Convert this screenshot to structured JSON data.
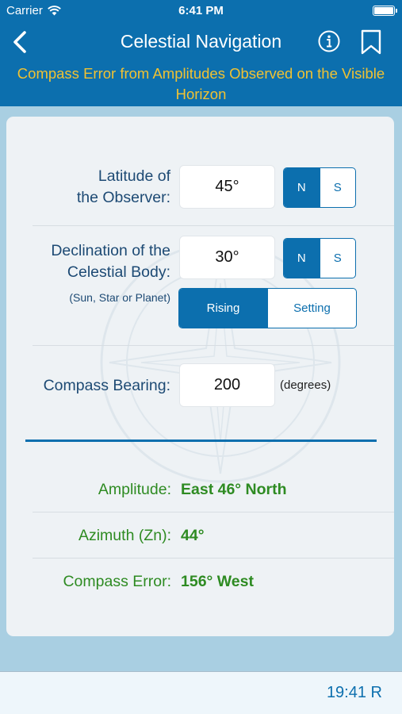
{
  "status": {
    "carrier": "Carrier",
    "time": "6:41 PM"
  },
  "nav": {
    "title": "Celestial Navigation",
    "subtitle": "Compass Error from Amplitudes Observed on the Visible Horizon"
  },
  "latitude": {
    "label_line1": "Latitude of",
    "label_line2": "the Observer:",
    "value": "45°",
    "hemisphere_options": [
      "N",
      "S"
    ],
    "selected": "N"
  },
  "declination": {
    "label_line1": "Declination of the",
    "label_line2": "Celestial Body:",
    "note": "(Sun, Star or Planet)",
    "value": "30°",
    "hemisphere_options": [
      "N",
      "S"
    ],
    "selected": "N",
    "event_options": [
      "Rising",
      "Setting"
    ],
    "event_selected": "Rising"
  },
  "compass": {
    "label": "Compass Bearing:",
    "value": "200",
    "units": "(degrees)"
  },
  "results": {
    "amplitude": {
      "label": "Amplitude:",
      "value": "East 46° North"
    },
    "azimuth": {
      "label": "Azimuth (Zn):",
      "value": "44°"
    },
    "compass_error": {
      "label": "Compass Error:",
      "value": "156° West"
    }
  },
  "toolbar": {
    "clock": "19:41 R"
  },
  "colors": {
    "primary": "#0c6fae",
    "accent": "#f1c232",
    "result": "#2e8b22",
    "label": "#1d4a74"
  }
}
